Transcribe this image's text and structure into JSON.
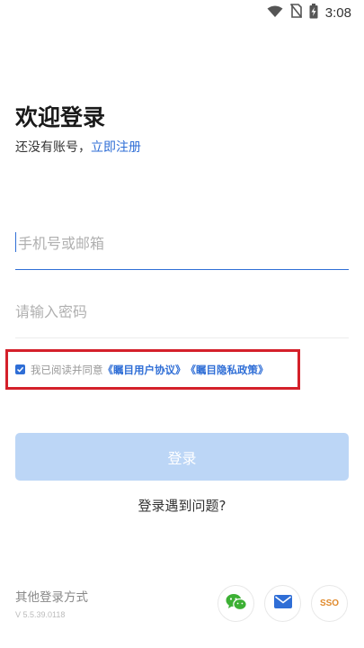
{
  "status_bar": {
    "time": "3:08",
    "icons": [
      "wifi-icon",
      "no-sim-icon",
      "battery-charging-icon"
    ]
  },
  "login": {
    "title": "欢迎登录",
    "subtitle_prefix": "还没有账号，",
    "register_link": "立即注册",
    "phone_placeholder": "手机号或邮箱",
    "password_placeholder": "请输入密码",
    "agreement": {
      "prefix": "我已阅读并同意",
      "terms_link": "《瞩目用户协议》",
      "privacy_link": "《瞩目隐私政策》",
      "checked": true
    },
    "login_button": "登录",
    "help_link": "登录遇到问题?",
    "other_methods_label": "其他登录方式",
    "version": "V 5.5.39.0118",
    "social": [
      {
        "name": "wechat-icon",
        "color": "#3cb034"
      },
      {
        "name": "mail-icon",
        "color": "#2f6ed6"
      },
      {
        "name": "sso-icon",
        "label": "SSO",
        "color": "#e08a2c"
      }
    ]
  },
  "colors": {
    "accent": "#2f6ed6",
    "button_disabled": "#bcd6f6",
    "highlight_border": "#d4202a"
  }
}
